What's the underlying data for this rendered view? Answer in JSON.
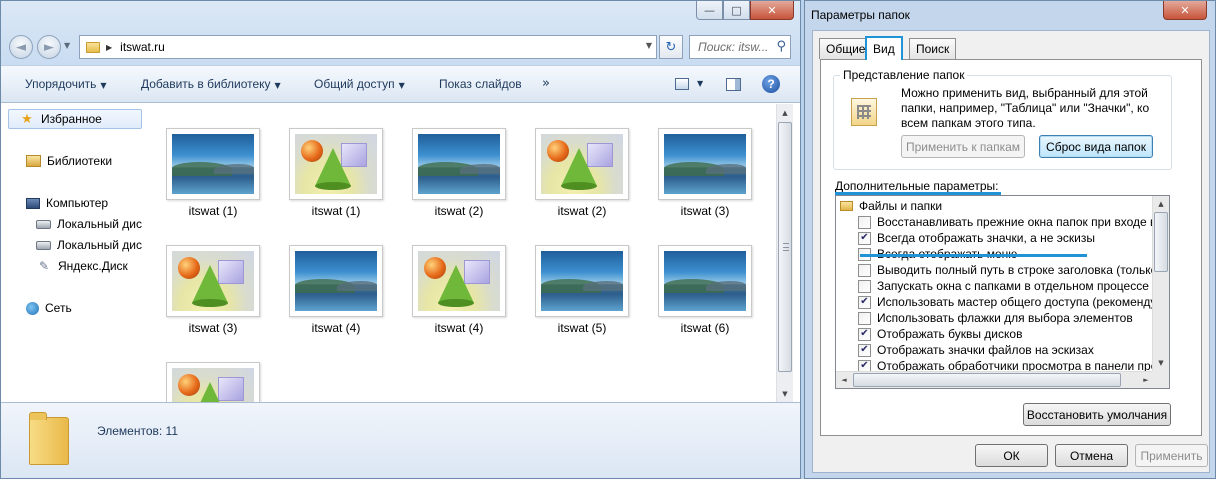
{
  "explorer": {
    "window_buttons": {
      "minimize": "—",
      "maximize": "□",
      "close": "✕"
    },
    "nav": {
      "back_glyph": "◄",
      "forward_glyph": "►"
    },
    "address": {
      "path": "itswat.ru"
    },
    "search": {
      "placeholder": "Поиск: itsw..."
    },
    "toolbar": {
      "organize": "Упорядочить",
      "add_to_library": "Добавить в библиотеку",
      "share": "Общий доступ",
      "slideshow": "Показ слайдов",
      "more": "»"
    },
    "nav_pane": {
      "favorites": "Избранное",
      "libraries": "Библиотеки",
      "computer": "Компьютер",
      "drive1": "Локальный дис",
      "drive2": "Локальный дис",
      "yandex_disk": "Яндекс.Диск",
      "network": "Сеть"
    },
    "files": [
      {
        "name": "itswat (1)",
        "kind": "landscape"
      },
      {
        "name": "itswat (1)",
        "kind": "shapes"
      },
      {
        "name": "itswat (2)",
        "kind": "landscape"
      },
      {
        "name": "itswat (2)",
        "kind": "shapes"
      },
      {
        "name": "itswat (3)",
        "kind": "landscape"
      },
      {
        "name": "itswat (3)",
        "kind": "shapes"
      },
      {
        "name": "itswat (4)",
        "kind": "landscape"
      },
      {
        "name": "itswat (4)",
        "kind": "shapes"
      },
      {
        "name": "itswat (5)",
        "kind": "landscape"
      },
      {
        "name": "itswat (6)",
        "kind": "landscape"
      },
      {
        "name": "",
        "kind": "shapes"
      }
    ],
    "status": {
      "items_count": "Элементов: 11"
    }
  },
  "dialog": {
    "title": "Параметры папок",
    "close_glyph": "✕",
    "tabs": [
      "Общие",
      "Вид",
      "Поиск"
    ],
    "active_tab": "Вид",
    "folder_views": {
      "legend": "Представление папок",
      "description": "Можно применить вид, выбранный для этой папки, например, \"Таблица\" или \"Значки\", ко всем папкам этого типа.",
      "apply_button": "Применить к папкам",
      "reset_button": "Сброс вида папок"
    },
    "advanced": {
      "label": "Дополнительные параметры:",
      "root": "Файлы и папки",
      "options": [
        {
          "text": "Восстанавливать прежние окна папок при входе в си",
          "checked": false
        },
        {
          "text": "Всегда отображать значки, а не эскизы",
          "checked": true
        },
        {
          "text": "Всегда отображать меню",
          "checked": false
        },
        {
          "text": "Выводить полный путь в строке заголовка (только д",
          "checked": false
        },
        {
          "text": "Запускать окна с папками в отдельном процессе",
          "checked": false
        },
        {
          "text": "Использовать мастер общего доступа (рекомендует",
          "checked": true
        },
        {
          "text": "Использовать флажки для выбора элементов",
          "checked": false
        },
        {
          "text": "Отображать буквы дисков",
          "checked": true
        },
        {
          "text": "Отображать значки файлов на эскизах",
          "checked": true
        },
        {
          "text": "Отображать обработчики просмотра в панели просм",
          "checked": true
        }
      ],
      "restore_defaults": "Восстановить умолчания"
    },
    "buttons": {
      "ok": "ОК",
      "cancel": "Отмена",
      "apply": "Применить"
    },
    "accent_color": "#1f93d6"
  }
}
